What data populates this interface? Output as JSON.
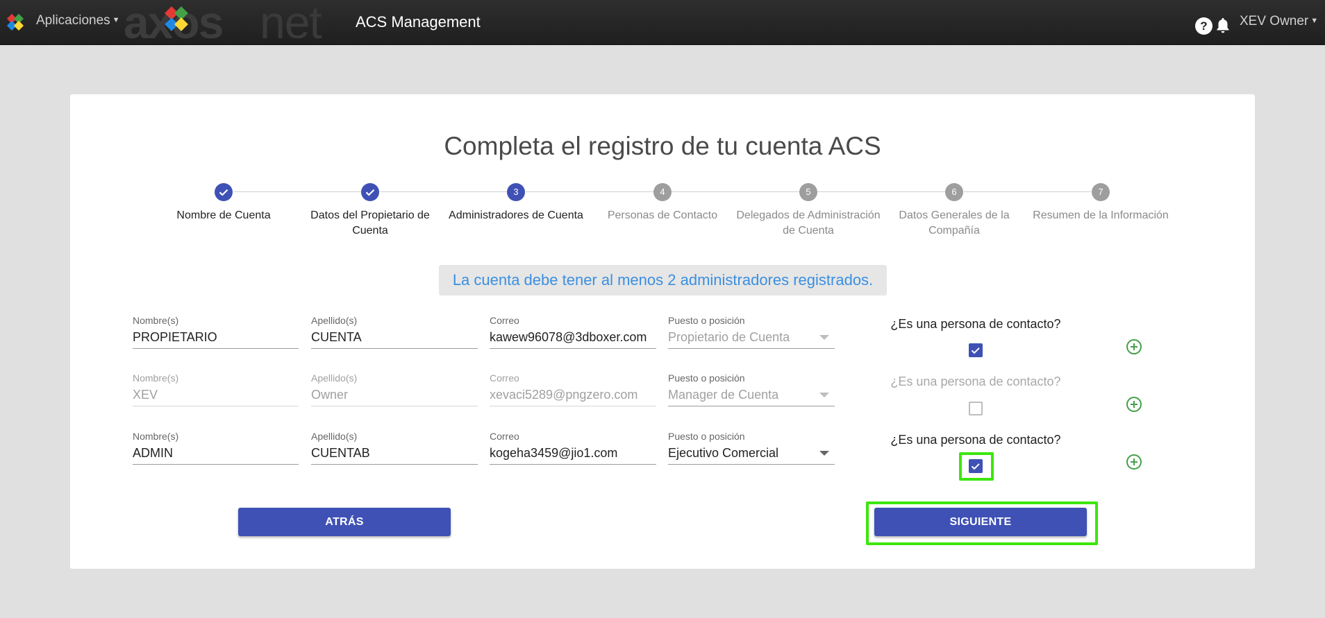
{
  "topbar": {
    "apps_label": "Aplicaciones",
    "brand_left": "axos",
    "brand_right": "net",
    "title": "ACS Management",
    "help_icon": "?",
    "user_label": "XEV Owner"
  },
  "page_title": "Completa el registro de tu cuenta ACS",
  "steps": [
    {
      "number": "1",
      "label": "Nombre de Cuenta",
      "status": "done"
    },
    {
      "number": "2",
      "label": "Datos del Propietario de Cuenta",
      "status": "done"
    },
    {
      "number": "3",
      "label": "Administradores de Cuenta",
      "status": "active"
    },
    {
      "number": "4",
      "label": "Personas de Contacto",
      "status": "pending"
    },
    {
      "number": "5",
      "label": "Delegados de Administración de Cuenta",
      "status": "pending"
    },
    {
      "number": "6",
      "label": "Datos Generales de la Compañía",
      "status": "pending"
    },
    {
      "number": "7",
      "label": "Resumen de la Información",
      "status": "pending"
    }
  ],
  "notice": "La cuenta debe tener al menos 2 administradores registrados.",
  "labels": {
    "nombre": "Nombre(s)",
    "apellido": "Apellido(s)",
    "correo": "Correo",
    "puesto": "Puesto o posición",
    "contact_question": "¿Es una persona de contacto?"
  },
  "admins": [
    {
      "nombre": "PROPIETARIO",
      "apellido": "CUENTA",
      "correo": "kawew96078@3dboxer.com",
      "puesto": "Propietario de Cuenta",
      "is_contact": true,
      "disabled": false
    },
    {
      "nombre": "XEV",
      "apellido": "Owner",
      "correo": "xevaci5289@pngzero.com",
      "puesto": "Manager de Cuenta",
      "is_contact": false,
      "disabled": true
    },
    {
      "nombre": "ADMIN",
      "apellido": "CUENTAB",
      "correo": "kogeha3459@jio1.com",
      "puesto": "Ejecutivo Comercial",
      "is_contact": true,
      "disabled": false
    }
  ],
  "buttons": {
    "back": "ATRÁS",
    "next": "SIGUIENTE"
  },
  "colors": {
    "primary": "#3f51b5",
    "highlight": "#3de60d",
    "notice_text": "#3b8fe0",
    "add_icon": "#43a047"
  }
}
